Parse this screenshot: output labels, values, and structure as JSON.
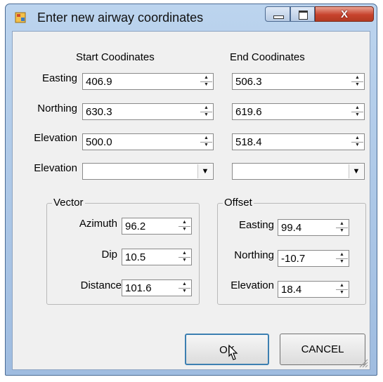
{
  "window": {
    "title": "Enter new airway coordinates",
    "app_icon": "app-icon",
    "close_glyph": "X"
  },
  "columns": {
    "start": "Start Coodinates",
    "end": "End Coodinates"
  },
  "rows": [
    {
      "label": "Easting",
      "start": "406.9",
      "end": "506.3"
    },
    {
      "label": "Northing",
      "start": "630.3",
      "end": "619.6"
    },
    {
      "label": "Elevation",
      "start": "500.0",
      "end": "518.4"
    }
  ],
  "combo_row": {
    "label": "Elevation",
    "start_value": "",
    "end_value": ""
  },
  "vector": {
    "title": "Vector",
    "fields": [
      {
        "label": "Azimuth",
        "value": "96.2"
      },
      {
        "label": "Dip",
        "value": "10.5"
      },
      {
        "label": "Distance",
        "value": "101.6"
      }
    ]
  },
  "offset": {
    "title": "Offset",
    "fields": [
      {
        "label": "Easting",
        "value": "99.4"
      },
      {
        "label": "Northing",
        "value": "-10.7"
      },
      {
        "label": "Elevation",
        "value": "18.4"
      }
    ]
  },
  "buttons": {
    "ok": "OK",
    "cancel": "CANCEL"
  },
  "icons": {
    "spin_up": "▲",
    "spin_down": "▼",
    "dropdown": "▼"
  }
}
